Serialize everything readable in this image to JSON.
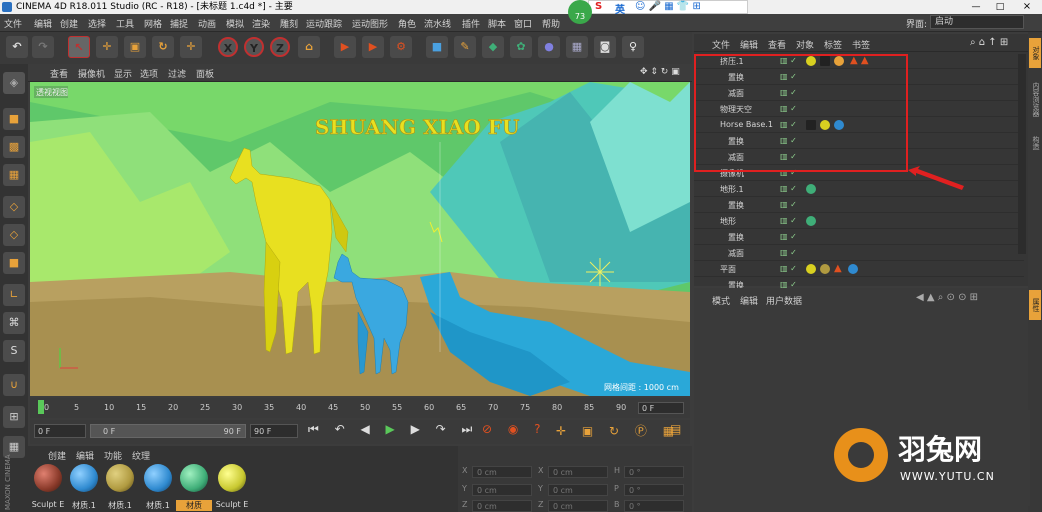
{
  "window": {
    "title": "CINEMA 4D R18.011 Studio (RC - R18) - [未标题 1.c4d *] - 主要",
    "min_btn": "—",
    "max_btn": "□",
    "close_btn": "×"
  },
  "ime": {
    "brand": "S",
    "lang": "英"
  },
  "layout_label": "界面:",
  "layout_value": "启动",
  "menu": [
    "文件",
    "编辑",
    "创建",
    "选择",
    "工具",
    "网格",
    "捕捉",
    "动画",
    "模拟",
    "渲染",
    "雕刻",
    "运动跟踪",
    "运动图形",
    "角色",
    "流水线",
    "插件",
    "脚本",
    "窗口",
    "帮助"
  ],
  "toolbar": {
    "undo": "↶",
    "move": "✛",
    "scale": "▣",
    "rotate": "↻",
    "all": "✛",
    "x": "X",
    "y": "Y",
    "z": "Z"
  },
  "viewport": {
    "menu": [
      "查看",
      "摄像机",
      "显示",
      "选项",
      "过滤",
      "面板"
    ],
    "label": "透视视图",
    "title_text": "SHUANG XIAO FU",
    "grid_info": "网格间距 : 1000 cm"
  },
  "timeline": {
    "ticks": [
      "0",
      "5",
      "10",
      "15",
      "20",
      "25",
      "30",
      "35",
      "40",
      "45",
      "50",
      "55",
      "60",
      "65",
      "70",
      "75",
      "80",
      "85",
      "90"
    ],
    "frame_field": "0 F"
  },
  "transport": {
    "start": "0 F",
    "range_start": "0 F",
    "range_end": "90 F",
    "end": "90 F"
  },
  "material_panel": {
    "menu": [
      "创建",
      "编辑",
      "功能",
      "纹理"
    ],
    "materials": [
      {
        "name": "Sculpt E",
        "color": "#8a3a2a"
      },
      {
        "name": "材质.1",
        "color": "#2f8ad0"
      },
      {
        "name": "材质.1",
        "color": "#b09a40"
      },
      {
        "name": "材质.1",
        "color": "#2f8ad0"
      },
      {
        "name": "材质",
        "color": "#3fae78"
      },
      {
        "name": "Sculpt E",
        "color": "#c8c830"
      }
    ],
    "vertical_label": "MAXON CINEMA 4D"
  },
  "coord_panel": {
    "rows": [
      {
        "a": "X",
        "av": "0 cm",
        "b": "X",
        "bv": "0 cm",
        "c": "H",
        "cv": "0 °"
      },
      {
        "a": "Y",
        "av": "0 cm",
        "b": "Y",
        "bv": "0 cm",
        "c": "P",
        "cv": "0 °"
      },
      {
        "a": "Z",
        "av": "0 cm",
        "b": "Z",
        "bv": "0 cm",
        "c": "B",
        "cv": "0 °"
      }
    ]
  },
  "object_manager": {
    "menu": [
      "文件",
      "编辑",
      "查看",
      "对象",
      "标签",
      "书签"
    ],
    "objects": [
      {
        "name": "挤压.1",
        "indent": 0,
        "tags": [
          "#d8d020",
          "#222",
          "#e8a23a",
          "#e05020",
          "#e05020"
        ]
      },
      {
        "name": "置换",
        "indent": 1,
        "tags": []
      },
      {
        "name": "减面",
        "indent": 1,
        "tags": []
      },
      {
        "name": "物理天空",
        "indent": 0,
        "tags": []
      },
      {
        "name": "Horse Base.1",
        "indent": 0,
        "tags": [
          "#222",
          "#d8d020",
          "#2f8ad0"
        ]
      },
      {
        "name": "置换",
        "indent": 1,
        "tags": []
      },
      {
        "name": "减面",
        "indent": 1,
        "tags": []
      },
      {
        "name": "摄像机",
        "indent": 0,
        "tags": []
      },
      {
        "name": "地形.1",
        "indent": 0,
        "tags": [
          "#3fae78"
        ]
      },
      {
        "name": "置换",
        "indent": 1,
        "tags": []
      },
      {
        "name": "地形",
        "indent": 0,
        "tags": [
          "#3fae78"
        ]
      },
      {
        "name": "置换",
        "indent": 1,
        "tags": []
      },
      {
        "name": "减面",
        "indent": 1,
        "tags": []
      },
      {
        "name": "平面",
        "indent": 0,
        "tags": [
          "#d8d020",
          "#b09a40",
          "#e05020",
          "#2f8ad0"
        ]
      },
      {
        "name": "置换",
        "indent": 1,
        "tags": []
      }
    ]
  },
  "attr_manager": {
    "menu": [
      "模式",
      "编辑",
      "用户数据"
    ]
  },
  "right_tabs": [
    "对象",
    "内容浏览器",
    "构造",
    "属性"
  ],
  "watermark": {
    "brand": "羽兔网",
    "url": "WWW.YUTU.CN"
  },
  "badge": "73"
}
